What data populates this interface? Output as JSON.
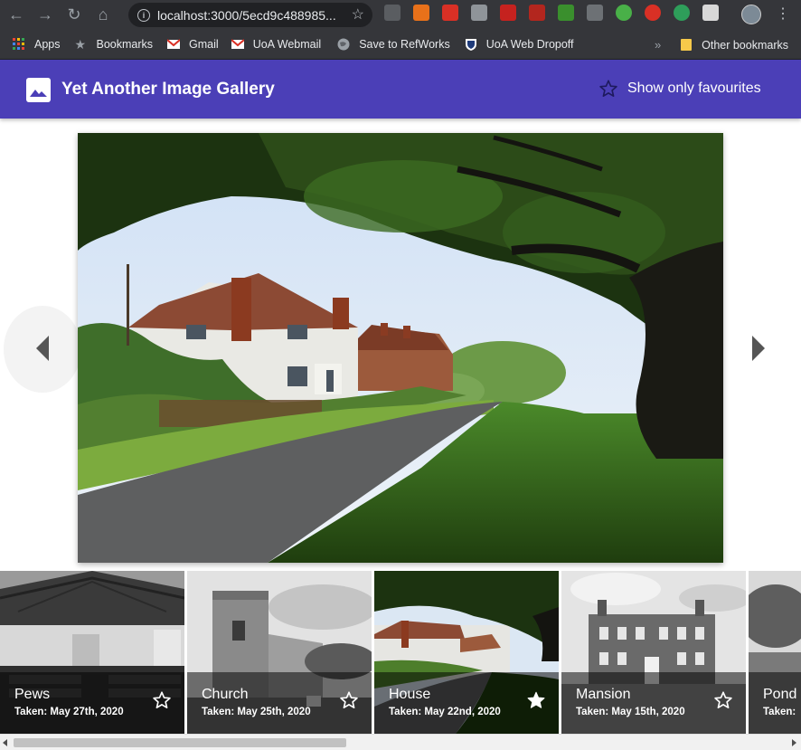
{
  "browser": {
    "url": "localhost:3000/5ecd9c488985...",
    "bookmarks": [
      {
        "label": "Apps",
        "icon": "apps-grid-icon"
      },
      {
        "label": "Bookmarks",
        "icon": "star-icon"
      },
      {
        "label": "Gmail",
        "icon": "gmail-icon"
      },
      {
        "label": "UoA Webmail",
        "icon": "gmail-icon"
      },
      {
        "label": "Save to RefWorks",
        "icon": "globe-icon"
      },
      {
        "label": "UoA Web Dropoff",
        "icon": "shield-crest-icon"
      }
    ],
    "other_bookmarks": "Other bookmarks",
    "overflow_chevron": "»"
  },
  "app": {
    "title": "Yet Another Image Gallery",
    "favourites_toggle": "Show only favourites",
    "accent": "#4b3fb7"
  },
  "thumbnails": [
    {
      "title": "Pews",
      "date": "Taken: May 27th, 2020",
      "favourite": false
    },
    {
      "title": "Church",
      "date": "Taken: May 25th, 2020",
      "favourite": false
    },
    {
      "title": "House",
      "date": "Taken: May 22nd, 2020",
      "favourite": true
    },
    {
      "title": "Mansion",
      "date": "Taken: May 15th, 2020",
      "favourite": false
    },
    {
      "title": "Pond",
      "date": "Taken:",
      "favourite": false
    }
  ]
}
